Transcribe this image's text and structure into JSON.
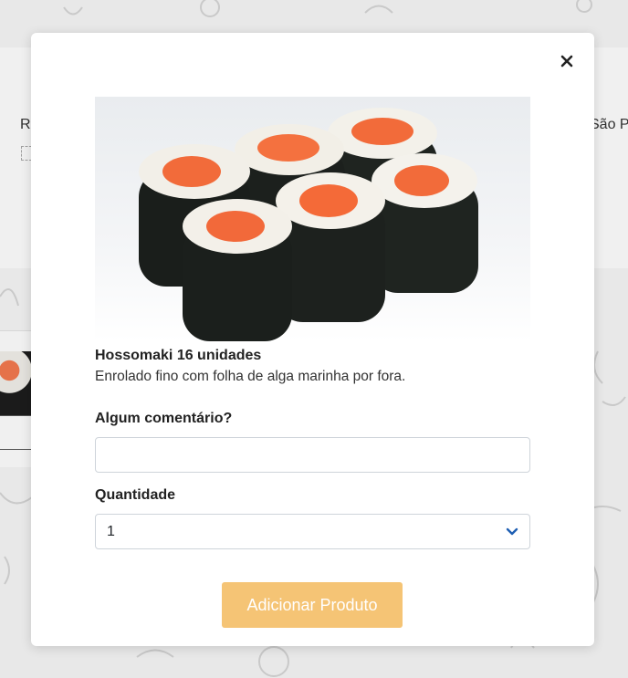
{
  "background_page": {
    "left_text": "R",
    "right_text": "São P"
  },
  "modal": {
    "close_icon": "close-icon",
    "product": {
      "name": "Hossomaki 16 unidades",
      "description": "Enrolado fino com folha de alga marinha por fora.",
      "image_alt": "Hossomaki"
    },
    "comment": {
      "label": "Algum comentário?",
      "value": "",
      "placeholder": ""
    },
    "quantity": {
      "label": "Quantidade",
      "selected": "1"
    },
    "add_button_label": "Adicionar Produto"
  },
  "colors": {
    "accent_button": "#f5c475",
    "chevron": "#1f5fb3",
    "salmon": "#f26b3a",
    "nori": "#1f2420"
  }
}
